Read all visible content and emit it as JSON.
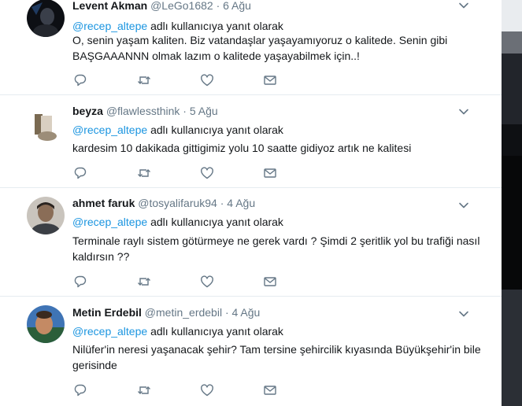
{
  "tweets": [
    {
      "name": "Levent Akman",
      "handle": "@LeGo1682",
      "time": "6 Ağu",
      "reply_mention": "@recep_altepe",
      "reply_text": "adlı kullanıcıya yanıt olarak",
      "body": "O, senin yaşam kaliten. Biz vatandaşlar yaşayamıyoruz o kalitede. Senin gibi BAŞGAAANNN olmak lazım o kalitede yaşayabilmek için..!"
    },
    {
      "name": "beyza",
      "handle": "@flawlessthink",
      "time": "5 Ağu",
      "reply_mention": "@recep_altepe",
      "reply_text": "adlı kullanıcıya yanıt olarak",
      "body": "kardesim 10 dakikada gittigimiz yolu 10 saatte gidiyoz artık ne kalitesi"
    },
    {
      "name": "ahmet faruk",
      "handle": "@tosyalifaruk94",
      "time": "4 Ağu",
      "reply_mention": "@recep_altepe",
      "reply_text": "adlı kullanıcıya yanıt olarak",
      "body": "Terminale raylı sistem götürmeye ne gerek vardı  ? Şimdi  2 şeritlik yol bu trafiği nasıl kaldırsın  ??"
    },
    {
      "name": "Metin Erdebil",
      "handle": "@metin_erdebil",
      "time": "4 Ağu",
      "reply_mention": "@recep_altepe",
      "reply_text": "adlı kullanıcıya yanıt olarak",
      "body": "Nilüfer'in neresi yaşanacak şehir? Tam tersine şehircilik kıyasında Büyükşehir'in bile gerisinde"
    }
  ],
  "icons": {
    "reply": "reply-icon",
    "retweet": "retweet-icon",
    "like": "heart-icon",
    "dm": "envelope-icon",
    "more": "chevron-down-icon"
  },
  "colors": {
    "mention": "#1b95e0",
    "meta": "#657786",
    "icon": "#657786",
    "divider": "#e6ecf0"
  }
}
